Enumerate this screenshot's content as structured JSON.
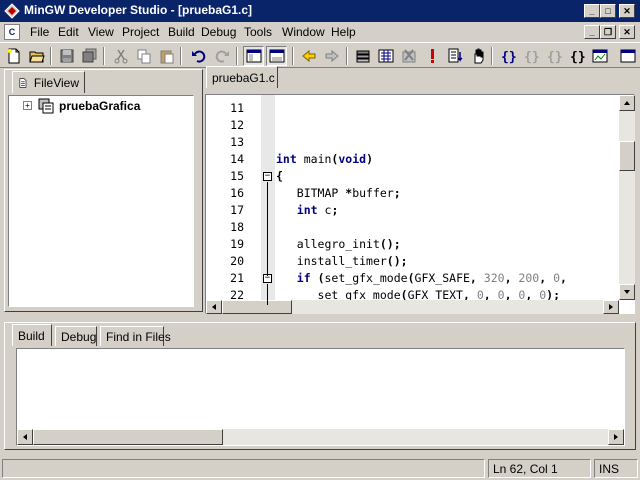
{
  "window": {
    "title": "MinGW Developer Studio - [pruebaG1.c]",
    "buttons": {
      "minimize": "_",
      "maximize": "□",
      "close": "✕"
    }
  },
  "menubar": {
    "doc_icon": "C",
    "items": [
      {
        "label": "File"
      },
      {
        "label": "Edit"
      },
      {
        "label": "View"
      },
      {
        "label": "Project"
      },
      {
        "label": "Build"
      },
      {
        "label": "Debug"
      },
      {
        "label": "Tools"
      },
      {
        "label": "Window"
      },
      {
        "label": "Help"
      }
    ],
    "mdi_buttons": {
      "minimize": "_",
      "restore": "❐",
      "close": "✕"
    }
  },
  "toolbar": {
    "icons": [
      "new-file-icon",
      "open-folder-icon",
      "save-icon",
      "save-all-icon",
      "cut-icon",
      "copy-icon",
      "paste-icon",
      "undo-icon",
      "redo-icon",
      "workspace-pane-icon",
      "output-pane-icon",
      "back-icon",
      "forward-icon",
      "compile-icon",
      "build-icon",
      "stop-build-icon",
      "execute-icon",
      "step-into-icon",
      "hand-icon",
      "bracket-icon",
      "bracket-icon",
      "bracket-icon",
      "bracket-icon",
      "window-icon",
      "window-icon"
    ]
  },
  "workspace": {
    "tab_label": "FileView",
    "tree": {
      "project_name": "pruebaGrafica",
      "expander": "+"
    }
  },
  "editor": {
    "tab_label": "pruebaG1.c",
    "line_numbers": [
      "11",
      "12",
      "13",
      "14",
      "15",
      "16",
      "17",
      "18",
      "19",
      "20",
      "21",
      "22"
    ],
    "fold_markers": [
      "−",
      "−"
    ],
    "code_lines": [
      "",
      "",
      "",
      "int main(void)",
      "{",
      "   BITMAP *buffer;",
      "   int c;",
      "",
      "   allegro_init();",
      "   install_timer();",
      "   if (set_gfx_mode(GFX_SAFE, 320, 200, 0,",
      "      set_gfx_mode(GFX_TEXT, 0, 0, 0, 0);"
    ]
  },
  "output": {
    "tabs": [
      {
        "label": "Build"
      },
      {
        "label": "Debug"
      },
      {
        "label": "Find in Files"
      }
    ]
  },
  "statusbar": {
    "message": "",
    "position": "Ln 62, Col 1",
    "mode": "INS"
  },
  "colors": {
    "titlebar": "#0a246a",
    "face": "#d4d0c8",
    "keyword": "#000080",
    "number": "#808080"
  }
}
